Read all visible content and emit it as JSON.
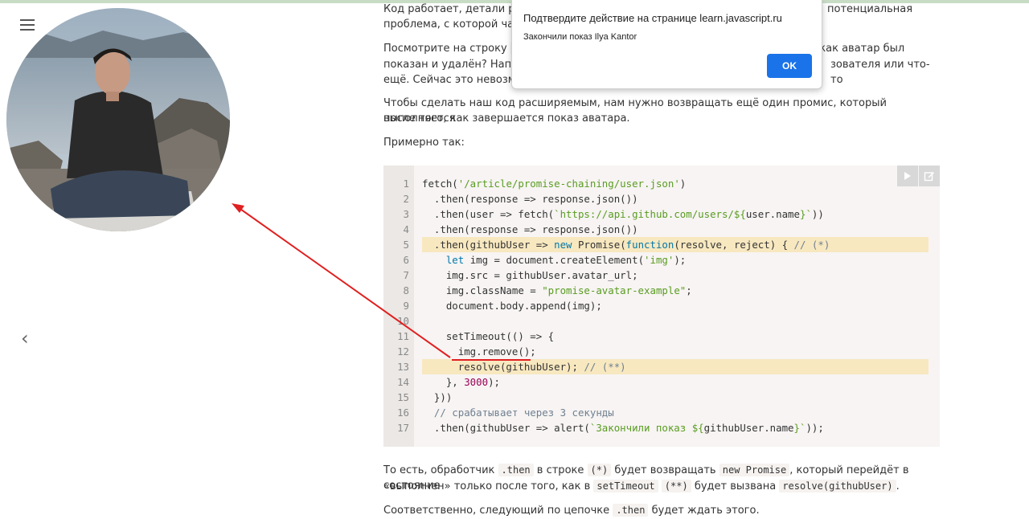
{
  "page": {
    "paragraphs": {
      "p1_a": "Код работает, детали реа",
      "p1_b": "потенциальная",
      "p1_c": "проблема, с которой час",
      "p2_a": "Посмотрите на строку",
      "p2_code": "(*",
      "p2_b": ", как аватар был",
      "p2_c": "показан и удалён? Напри",
      "p2_d": "зователя или что-то",
      "p2_e": "ещё. Сейчас это невозмо",
      "p3_line1": "Чтобы сделать наш код расширяемым, нам нужно возвращать ещё один промис, который выполняется",
      "p3_line2": "после того, как завершается показ аватара.",
      "p4": "Примерно так:",
      "p5_a": "То есть, обработчик",
      "p5_code1": ".then",
      "p5_b": "в строке",
      "p5_code2": "(*)",
      "p5_c": "будет возвращать",
      "p5_code3": "new Promise",
      "p5_d": ", который перейдёт в состояние",
      "p5_e": "«выполнен» только после того, как в",
      "p5_code4": "setTimeout",
      "p5_code5": "(**)",
      "p5_f": "будет вызвана",
      "p5_code6": "resolve(githubUser)",
      "p5_g": ".",
      "p6_a": "Соответственно, следующий по цепочке",
      "p6_code": ".then",
      "p6_b": "будет ждать этого."
    },
    "code": {
      "line_numbers": [
        "1",
        "2",
        "3",
        "4",
        "5",
        "6",
        "7",
        "8",
        "9",
        "10",
        "11",
        "12",
        "13",
        "14",
        "15",
        "16",
        "17"
      ],
      "highlighted_lines": [
        5,
        13
      ]
    },
    "dialog": {
      "title": "Подтвердите действие на странице learn.javascript.ru",
      "message": "Закончили показ Ilya Kantor",
      "ok_label": "OK"
    },
    "icons": {
      "menu": "hamburger-menu-icon",
      "prev": "chevron-left-icon",
      "run": "play-icon",
      "edit": "edit-icon"
    },
    "colors": {
      "accent_button": "#1a73e8",
      "highlight_line": "#f8e8c0",
      "arrow": "#e02020"
    }
  }
}
